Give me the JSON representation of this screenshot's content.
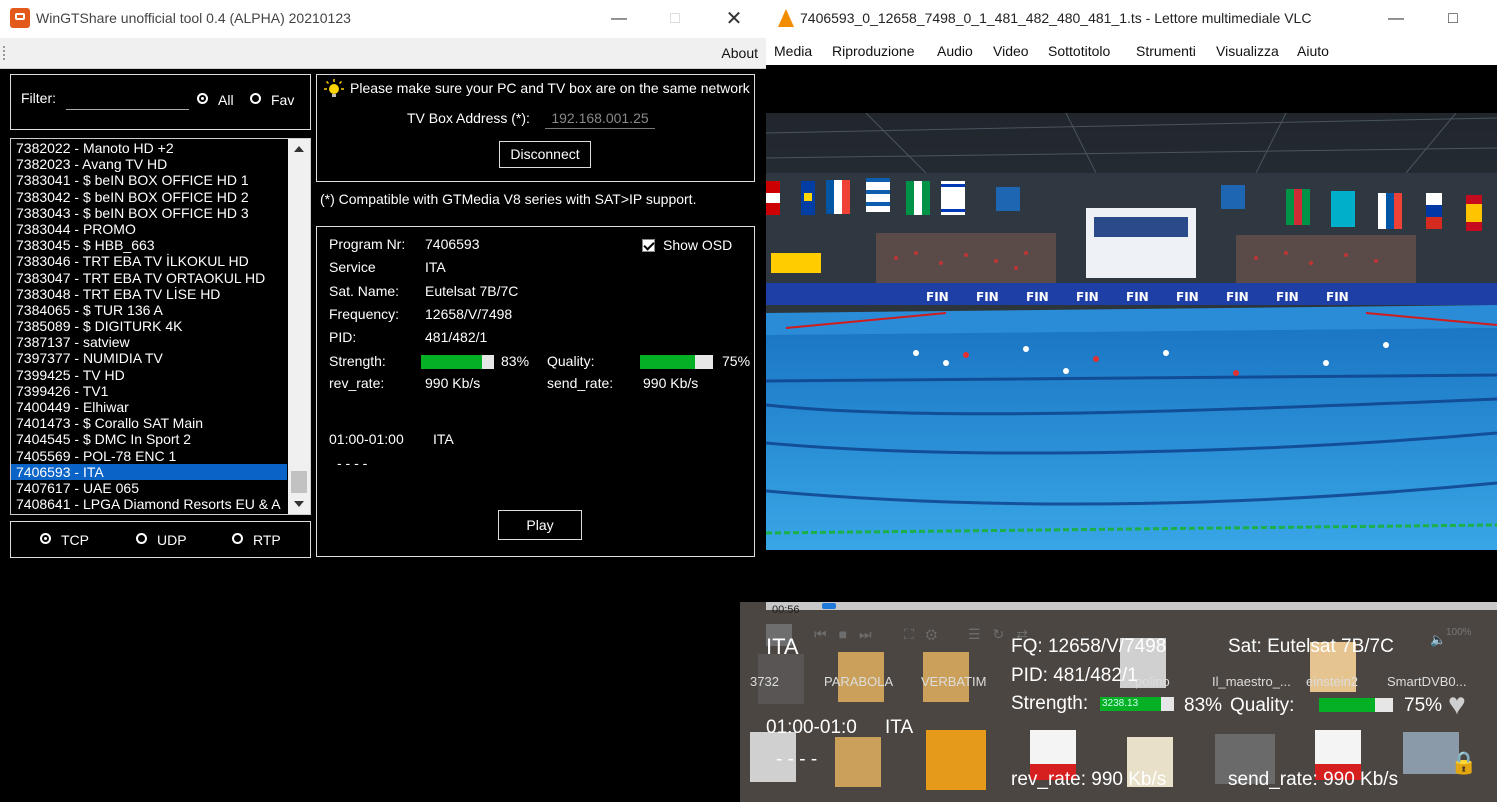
{
  "wingt": {
    "title": "WinGTShare unofficial tool 0.4 (ALPHA) 20210123",
    "menu_about": "About",
    "filter_label": "Filter:",
    "filter_value": "",
    "radio_all": "All",
    "radio_fav": "Fav",
    "channels": [
      "7382022 - Manoto HD +2",
      "7382023 - Avang TV HD",
      "7383041 - $ beIN BOX OFFICE HD 1",
      "7383042 - $ beIN BOX OFFICE HD 2",
      "7383043 - $ beIN BOX OFFICE HD 3",
      "7383044 - PROMO",
      "7383045 - $ HBB_663",
      "7383046 - TRT EBA TV İLKOKUL HD",
      "7383047 - TRT EBA TV ORTAOKUL HD",
      "7383048 - TRT EBA TV LİSE HD",
      "7384065 - $ TUR 136 A",
      "7385089 - $ DIGITURK 4K",
      "7387137 - satview",
      "7397377 - NUMIDIA TV",
      "7399425 - TV HD",
      "7399426 - TV1",
      "7400449 - Elhiwar",
      "7401473 - $ Corallo SAT Main",
      "7404545 - $ DMC In Sport 2",
      "7405569 - POL-78 ENC 1",
      "7406593 - ITA",
      "7407617 - UAE 065",
      "7408641 - LPGA Diamond Resorts EU & A"
    ],
    "selected_channel": "7406593 - ITA",
    "protocols": {
      "tcp": "TCP",
      "udp": "UDP",
      "rtp": "RTP",
      "selected": "TCP"
    },
    "network_notice": "Please make sure your PC and TV box are on the same network",
    "tvbox_label": "TV Box Address (*):",
    "tvbox_value": "192.168.001.25",
    "disconnect_label": "Disconnect",
    "compat_note": "(*) Compatible with GTMedia V8 series with SAT>IP support.",
    "info": {
      "program_nr_label": "Program Nr:",
      "program_nr": "7406593",
      "service_label": "Service",
      "service": "ITA",
      "sat_label": "Sat. Name:",
      "sat": "Eutelsat 7B/7C",
      "freq_label": "Frequency:",
      "freq": "12658/V/7498",
      "pid_label": "PID:",
      "pid": "481/482/1",
      "strength_label": "Strength:",
      "strength": "83%",
      "quality_label": "Quality:",
      "quality": "75%",
      "rev_label": "rev_rate:",
      "rev": "990 Kb/s",
      "send_label": "send_rate:",
      "send": "990 Kb/s"
    },
    "strength_level": 0.83,
    "quality_level": 0.75,
    "show_osd_label": "Show OSD",
    "show_osd_checked": true,
    "epg_time": "01:00-01:00",
    "epg_title": "ITA",
    "epg_desc": "- - - -",
    "play_label": "Play"
  },
  "vlc": {
    "title": "7406593_0_12658_7498_0_1_481_482_480_481_1.ts - Lettore multimediale VLC",
    "menu": [
      "Media",
      "Riproduzione",
      "Audio",
      "Video",
      "Sottotitolo",
      "Strumenti",
      "Visualizza",
      "Aiuto"
    ],
    "time_elapsed": "00:56",
    "volume": "100%"
  },
  "osd": {
    "service": "ITA",
    "fq": "FQ: 12658/V/7498",
    "sat": "Sat: Eutelsat 7B/7C",
    "pid": "PID: 481/482/1",
    "strength_label": "Strength:",
    "strength": "83%",
    "quality_label": "Quality:",
    "quality": "75%",
    "epg_time": "01:00-01:0",
    "epg_title": "ITA",
    "epg_desc": "- - - -",
    "rev_rate": "rev_rate: 990 Kb/s",
    "send_rate": "send_rate: 990 Kb/s",
    "strength_level": 0.83,
    "quality_level": 0.75,
    "bar_overlay_text": "3238.13"
  },
  "desktop_labels": [
    "3732",
    "PARABOLA",
    "VERBATIM",
    "polino",
    "Il_maestro_...",
    "einstein2",
    "SmartDVB0..."
  ],
  "colors": {
    "selection": "#0a64c8",
    "signal_green": "#06b025",
    "vlc_orange": "#f28c00",
    "app_orange": "#e2591b"
  }
}
